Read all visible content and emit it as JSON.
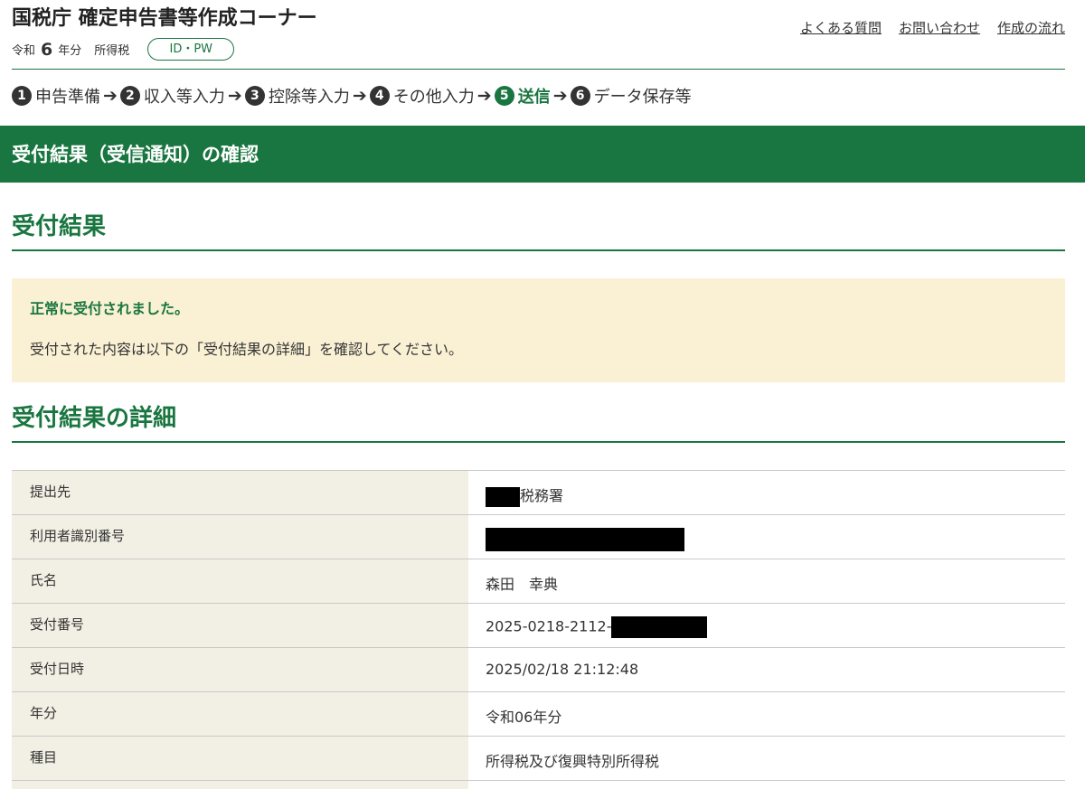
{
  "header": {
    "title": "国税庁 確定申告書等作成コーナー",
    "era": "令和",
    "year": "6",
    "year_suffix": "年分",
    "tax_kind": "所得税",
    "id_pw_label": "ID・PW",
    "links": [
      "よくある質問",
      "お問い合わせ",
      "作成の流れ"
    ]
  },
  "steps": [
    {
      "num": "1",
      "label": "申告準備"
    },
    {
      "num": "2",
      "label": "収入等入力"
    },
    {
      "num": "3",
      "label": "控除等入力"
    },
    {
      "num": "4",
      "label": "その他入力"
    },
    {
      "num": "5",
      "label": "送信"
    },
    {
      "num": "6",
      "label": "データ保存等"
    }
  ],
  "current_step": "5",
  "page_title": "受付結果（受信通知）の確認",
  "section1_title": "受付結果",
  "notice": {
    "title": "正常に受付されました。",
    "text": "受付された内容は以下の「受付結果の詳細」を確認してください。"
  },
  "section2_title": "受付結果の詳細",
  "details": [
    {
      "label": "提出先",
      "value": "税務署"
    },
    {
      "label": "利用者識別番号",
      "value": ""
    },
    {
      "label": "氏名",
      "value": "森田　幸典"
    },
    {
      "label": "受付番号",
      "value": "2025-0218-2112-"
    },
    {
      "label": "受付日時",
      "value": "2025/02/18 21:12:48"
    },
    {
      "label": "年分",
      "value": "令和06年分"
    },
    {
      "label": "種目",
      "value": "所得税及び復興特別所得税"
    },
    {
      "label": "",
      "value": ""
    }
  ],
  "colors": {
    "accent": "#1a7640",
    "notice_bg": "#faf1d5",
    "label_bg": "#f2efe4"
  }
}
